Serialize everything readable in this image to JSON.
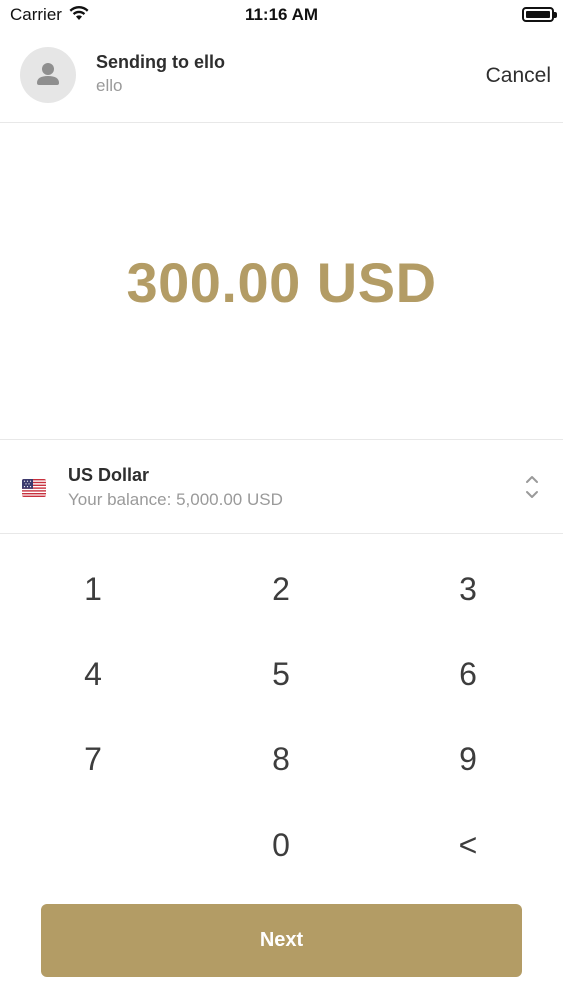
{
  "status_bar": {
    "carrier": "Carrier",
    "time": "11:16 AM"
  },
  "header": {
    "title": "Sending to ello",
    "subtitle": "ello",
    "cancel_label": "Cancel"
  },
  "amount": {
    "display": "300.00 USD"
  },
  "currency": {
    "name": "US Dollar",
    "balance_label": "Your balance: 5,000.00 USD",
    "flag_icon": "us-flag-icon"
  },
  "keypad": {
    "keys": [
      "1",
      "2",
      "3",
      "4",
      "5",
      "6",
      "7",
      "8",
      "9",
      "0",
      "<"
    ]
  },
  "next_label": "Next",
  "colors": {
    "accent": "#b39c65",
    "text": "#2e2e2e",
    "muted": "#9a9a9a"
  }
}
